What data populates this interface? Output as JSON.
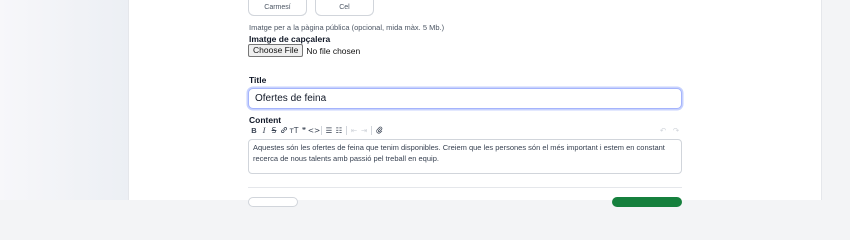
{
  "swatches": [
    {
      "label": "Carmesí"
    },
    {
      "label": "Cel"
    }
  ],
  "header_image": {
    "hint": "Imatge per a la pàgina pública (opcional, mida màx. 5 Mb.)",
    "label": "Imatge de capçalera",
    "button_label": "Choose File",
    "status": "No file chosen"
  },
  "title_field": {
    "label": "Title",
    "value": "Ofertes de feina"
  },
  "content_field": {
    "label": "Content",
    "toolbar": {
      "bold": "B",
      "italic": "I",
      "strike": "S",
      "link": "🔗",
      "heading": "ᴛT",
      "quote": "❞",
      "code": "<>",
      "bullets": "☰",
      "numbers": "☷",
      "outdent": "⇤",
      "indent": "⇥",
      "attach": "📎",
      "undo": "↶",
      "redo": "↷"
    },
    "text": "Aquestes són les ofertes de feina que tenim disponibles. Creiem que les persones són el més important i estem en constant recerca de nous talents amb passió pel treball en equip."
  }
}
